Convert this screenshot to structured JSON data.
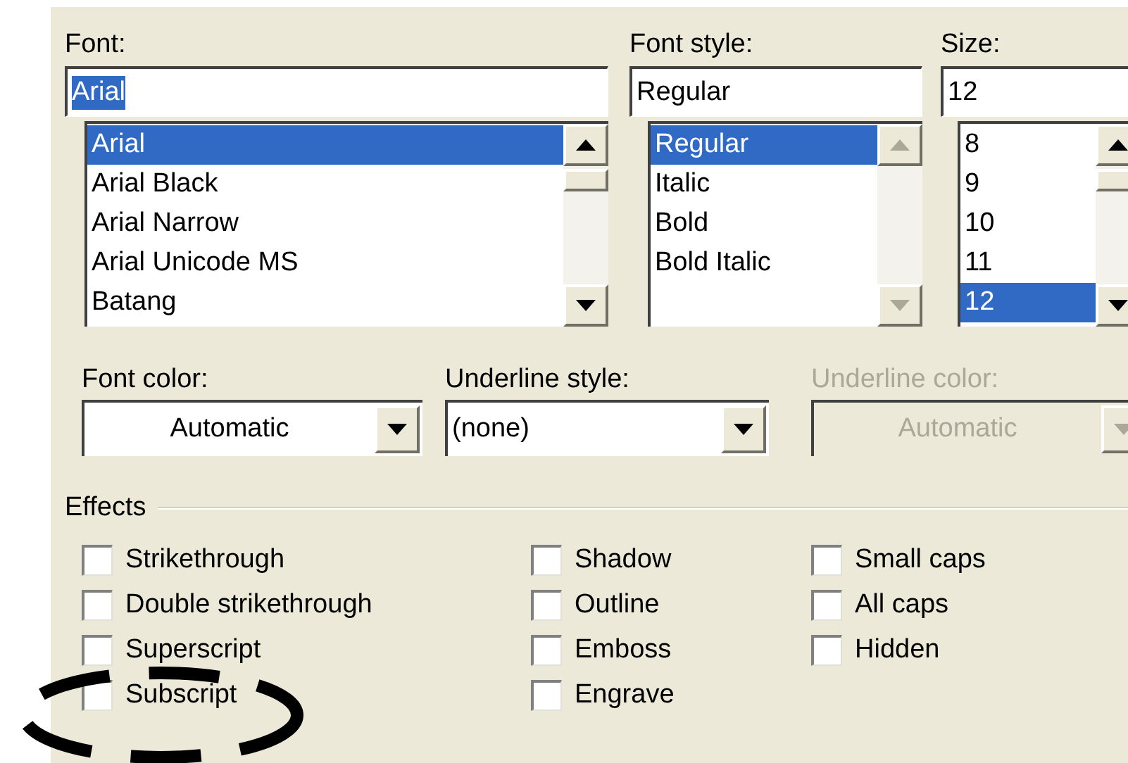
{
  "font": {
    "label": "Font:",
    "value": "Arial",
    "items": [
      {
        "text": "Arial",
        "selected": true
      },
      {
        "text": "Arial Black",
        "selected": false
      },
      {
        "text": "Arial Narrow",
        "selected": false
      },
      {
        "text": "Arial Unicode MS",
        "selected": false
      },
      {
        "text": "Batang",
        "selected": false
      }
    ]
  },
  "font_style": {
    "label": "Font style:",
    "value": "Regular",
    "items": [
      {
        "text": "Regular",
        "selected": true
      },
      {
        "text": "Italic",
        "selected": false
      },
      {
        "text": "Bold",
        "selected": false
      },
      {
        "text": "Bold Italic",
        "selected": false
      }
    ]
  },
  "size": {
    "label": "Size:",
    "value": "12",
    "items": [
      {
        "text": "8",
        "selected": false
      },
      {
        "text": "9",
        "selected": false
      },
      {
        "text": "10",
        "selected": false
      },
      {
        "text": "11",
        "selected": false
      },
      {
        "text": "12",
        "selected": true
      }
    ]
  },
  "dropdowns": [
    {
      "label": "Font color:",
      "value": "Automatic",
      "disabled": false
    },
    {
      "label": "Underline style:",
      "value": "(none)",
      "disabled": false
    },
    {
      "label": "Underline color:",
      "value": "Automatic",
      "disabled": true
    }
  ],
  "effects": {
    "title": "Effects",
    "columns": [
      [
        {
          "label": "Strikethrough",
          "checked": false
        },
        {
          "label": "Double strikethrough",
          "checked": false
        },
        {
          "label": "Superscript",
          "checked": false
        },
        {
          "label": "Subscript",
          "checked": false
        }
      ],
      [
        {
          "label": "Shadow",
          "checked": false
        },
        {
          "label": "Outline",
          "checked": false
        },
        {
          "label": "Emboss",
          "checked": false
        },
        {
          "label": "Engrave",
          "checked": false
        }
      ],
      [
        {
          "label": "Small caps",
          "checked": false
        },
        {
          "label": "All caps",
          "checked": false
        },
        {
          "label": "Hidden",
          "checked": false
        }
      ]
    ]
  }
}
